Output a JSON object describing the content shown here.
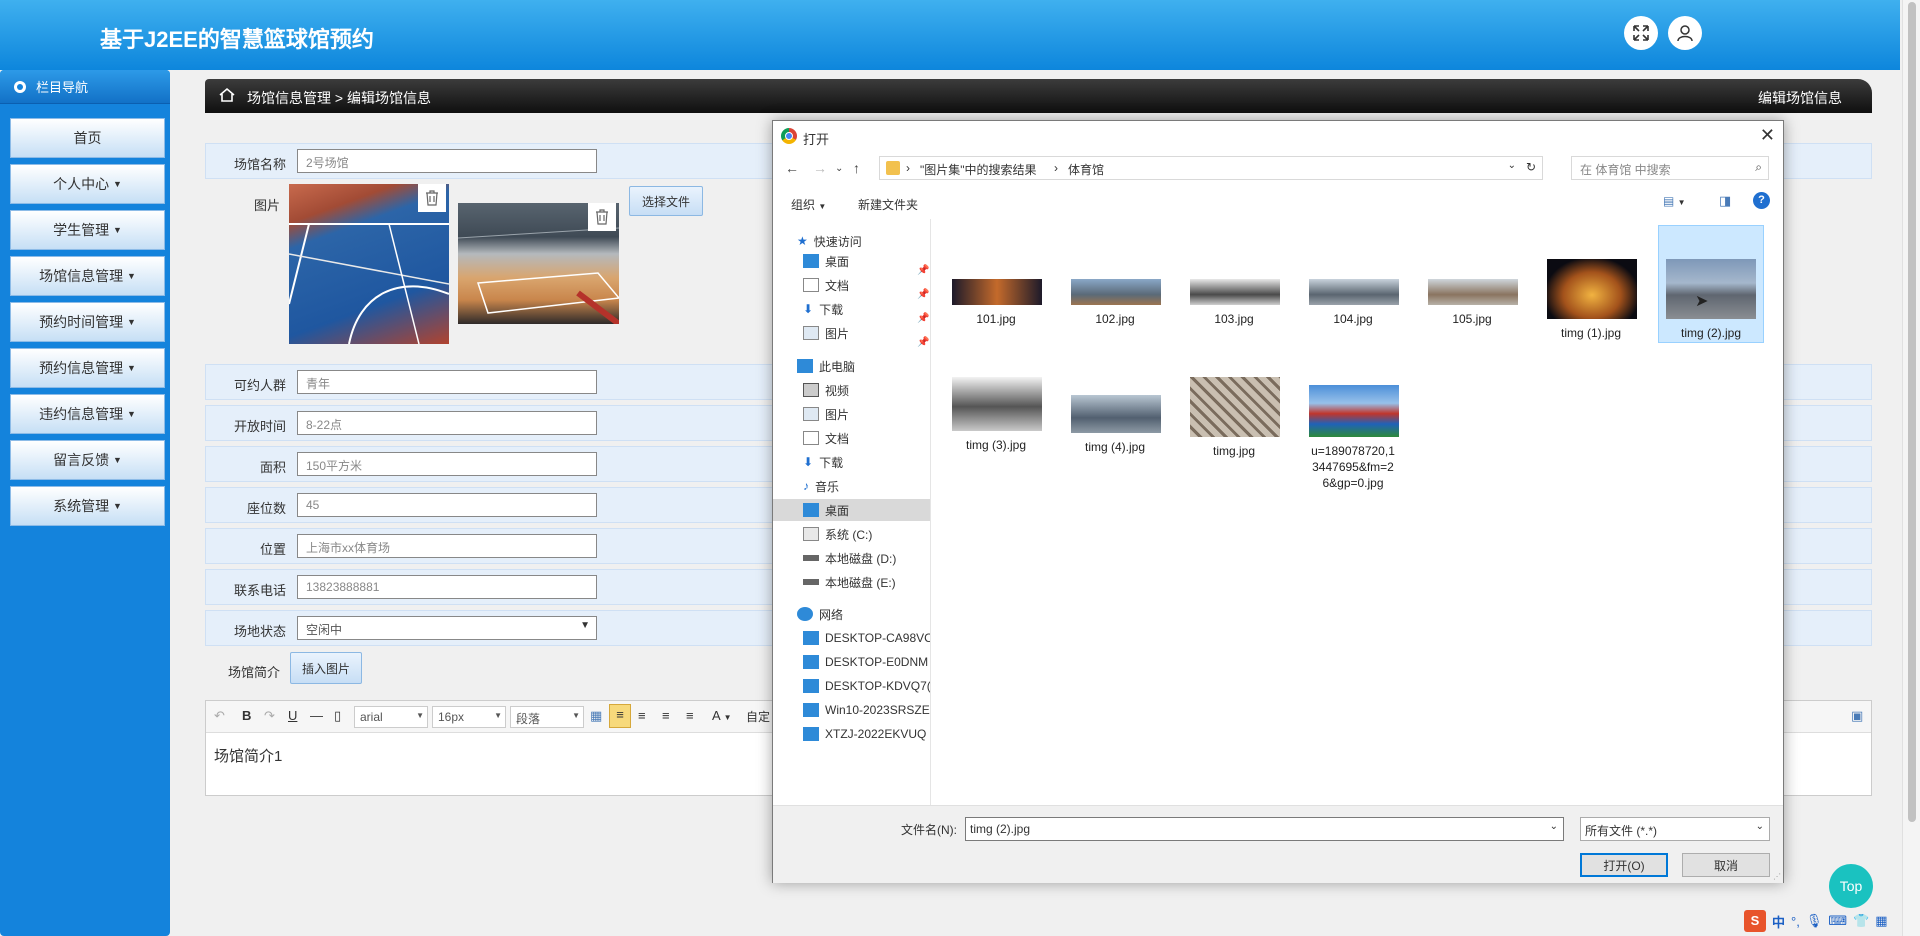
{
  "app": {
    "title": "基于J2EE的智慧篮球馆预约"
  },
  "sidebar": {
    "header": "栏目导航",
    "items": [
      {
        "label": "首页"
      },
      {
        "label": "个人中心"
      },
      {
        "label": "学生管理"
      },
      {
        "label": "场馆信息管理"
      },
      {
        "label": "预约时间管理"
      },
      {
        "label": "预约信息管理"
      },
      {
        "label": "违约信息管理"
      },
      {
        "label": "留言反馈"
      },
      {
        "label": "系统管理"
      }
    ]
  },
  "breadcrumb": {
    "path": "场馆信息管理 > 编辑场馆信息",
    "right": "编辑场馆信息"
  },
  "form": {
    "name_label": "场馆名称",
    "name_value": "2号场馆",
    "image_label": "图片",
    "choose_file": "选择文件",
    "crowd_label": "可约人群",
    "crowd_value": "青年",
    "open_label": "开放时间",
    "open_value": "8-22点",
    "area_label": "面积",
    "area_value": "150平方米",
    "seats_label": "座位数",
    "seats_value": "45",
    "location_label": "位置",
    "location_value": "上海市xx体育场",
    "phone_label": "联系电话",
    "phone_value": "13823888881",
    "status_label": "场地状态",
    "status_value": "空闲中",
    "intro_label": "场馆简介",
    "insert_image": "插入图片"
  },
  "editor": {
    "font": "arial",
    "size": "16px",
    "block": "段落",
    "custom": "自定",
    "bold": "B",
    "underline": "U",
    "fontcolor": "A",
    "content": "场馆简介1"
  },
  "top_button": "Top",
  "ime": {
    "mode": "中"
  },
  "dialog": {
    "title": "打开",
    "address": [
      "\"图片集\"中的搜索结果",
      "体育馆"
    ],
    "search_placeholder": "在 体育馆 中搜索",
    "organize": "组织",
    "new_folder": "新建文件夹",
    "nav": {
      "quick_access": "快速访问",
      "quick": [
        {
          "label": "桌面"
        },
        {
          "label": "文档"
        },
        {
          "label": "下载"
        },
        {
          "label": "图片"
        }
      ],
      "this_pc": "此电脑",
      "pc": [
        {
          "label": "视频"
        },
        {
          "label": "图片"
        },
        {
          "label": "文档"
        },
        {
          "label": "下载"
        },
        {
          "label": "音乐"
        },
        {
          "label": "桌面"
        },
        {
          "label": "系统 (C:)"
        },
        {
          "label": "本地磁盘 (D:)"
        },
        {
          "label": "本地磁盘 (E:)"
        }
      ],
      "network": "网络",
      "net": [
        {
          "label": "DESKTOP-CA98VC"
        },
        {
          "label": "DESKTOP-E0DNM"
        },
        {
          "label": "DESKTOP-KDVQ7("
        },
        {
          "label": "Win10-2023SRSZE"
        },
        {
          "label": "XTZJ-2022EKVUQ"
        }
      ]
    },
    "files": [
      {
        "name": "101.jpg"
      },
      {
        "name": "102.jpg"
      },
      {
        "name": "103.jpg"
      },
      {
        "name": "104.jpg"
      },
      {
        "name": "105.jpg"
      },
      {
        "name": "timg (1).jpg"
      },
      {
        "name": "timg (2).jpg"
      },
      {
        "name": "timg (3).jpg"
      },
      {
        "name": "timg (4).jpg"
      },
      {
        "name": "timg.jpg"
      },
      {
        "name": "u=189078720,13447695&fm=26&gp=0.jpg"
      }
    ],
    "filename_label": "文件名(N):",
    "filename_value": "timg (2).jpg",
    "filetype": "所有文件 (*.*)",
    "open_button": "打开(O)",
    "cancel_button": "取消"
  }
}
